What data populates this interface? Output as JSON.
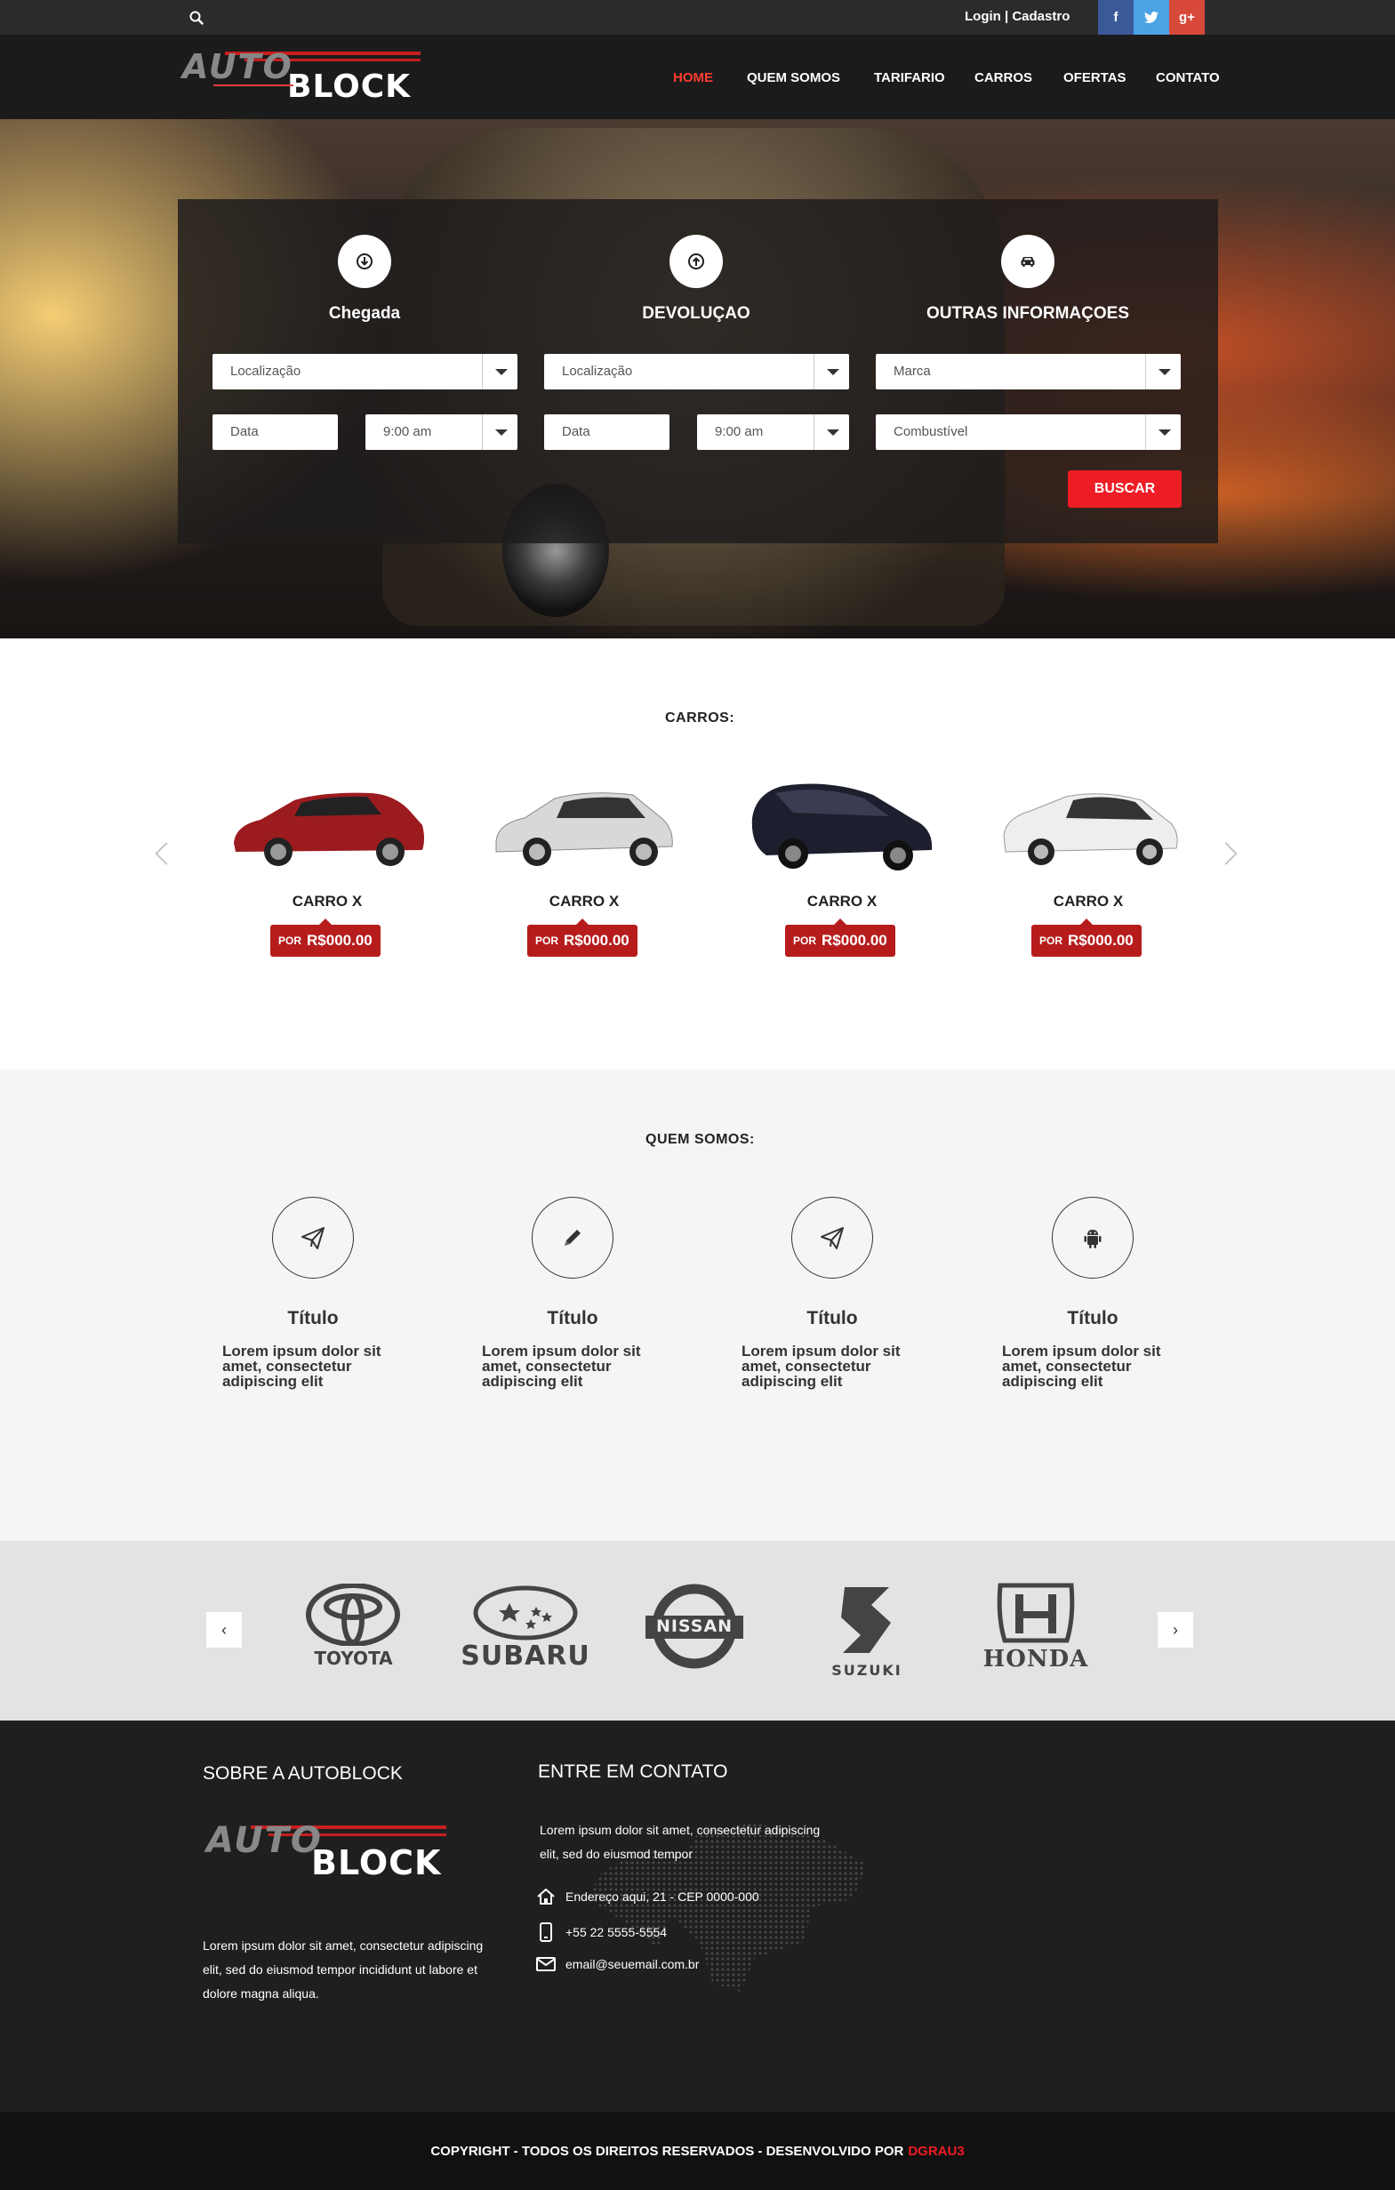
{
  "topbar": {
    "login_label": "Login | Cadastro",
    "social": {
      "facebook": "f",
      "twitter": "t",
      "googleplus": "g+"
    }
  },
  "logo": {
    "line1": "AUTO",
    "line2": "BLOCK"
  },
  "nav": {
    "items": [
      {
        "label": "HOME",
        "active": true
      },
      {
        "label": "QUEM SOMOS"
      },
      {
        "label": "TARIFARIO"
      },
      {
        "label": "CARROS"
      },
      {
        "label": "OFERTAS"
      },
      {
        "label": "CONTATO"
      }
    ]
  },
  "search_panel": {
    "columns": [
      {
        "title": "Chegada",
        "icon": "arrow-down-circle-icon"
      },
      {
        "title": "DEVOLUÇAO",
        "icon": "arrow-up-circle-icon"
      },
      {
        "title": "OUTRAS INFORMAÇOES",
        "icon": "car-icon"
      }
    ],
    "chegada": {
      "location_placeholder": "Localização",
      "date_placeholder": "Data",
      "time": "9:00 am"
    },
    "devolucao": {
      "location_placeholder": "Localização",
      "date_placeholder": "Data",
      "time": "9:00 am"
    },
    "outras": {
      "brand": "Marca",
      "fuel": "Combustível"
    },
    "button": "BUSCAR"
  },
  "cars_section": {
    "title": "CARROS:",
    "cars": [
      {
        "name": "CARRO X",
        "price_prefix": "POR",
        "price": "R$000.00",
        "color": "#9c1b1f"
      },
      {
        "name": "CARRO X",
        "price_prefix": "POR",
        "price": "R$000.00",
        "color": "#d8d8d8"
      },
      {
        "name": "CARRO X",
        "price_prefix": "POR",
        "price": "R$000.00",
        "color": "#1d1f2e"
      },
      {
        "name": "CARRO X",
        "price_prefix": "POR",
        "price": "R$000.00",
        "color": "#eeeeee"
      }
    ]
  },
  "about": {
    "title": "QUEM SOMOS:",
    "features": [
      {
        "icon": "paper-plane-icon",
        "title": "Título",
        "text": "Lorem ipsum dolor sit amet, consectetur adipiscing elit"
      },
      {
        "icon": "pencil-icon",
        "title": "Título",
        "text": "Lorem ipsum dolor sit amet, consectetur adipiscing elit"
      },
      {
        "icon": "paper-plane-icon",
        "title": "Título",
        "text": "Lorem ipsum dolor sit amet, consectetur adipiscing elit"
      },
      {
        "icon": "android-icon",
        "title": "Título",
        "text": "Lorem ipsum dolor sit amet, consectetur adipiscing elit"
      }
    ]
  },
  "brands": {
    "prev": "‹",
    "next": "›",
    "items": [
      "TOYOTA",
      "SUBARU",
      "NISSAN",
      "SUZUKI",
      "HONDA"
    ]
  },
  "footer": {
    "about_title": "SOBRE A AUTOBLOCK",
    "about_text": "Lorem ipsum dolor sit amet, consectetur adipiscing elit, sed do eiusmod tempor incididunt ut labore et dolore magna aliqua.",
    "contact_title": "ENTRE EM CONTATO",
    "contact_text": "Lorem ipsum dolor sit amet, consectetur adipiscing elit, sed do eiusmod tempor",
    "address": "Endereço aqui, 21 - CEP 0000-000",
    "phone": "+55 22 5555-5554",
    "email": "email@seuemail.com.br"
  },
  "copyright": {
    "text": "COPYRIGHT - TODOS OS DIREITOS RESERVADOS - DESENVOLVIDO POR",
    "brand": "DGRAU3",
    "brand_color": "#ee1c25"
  }
}
